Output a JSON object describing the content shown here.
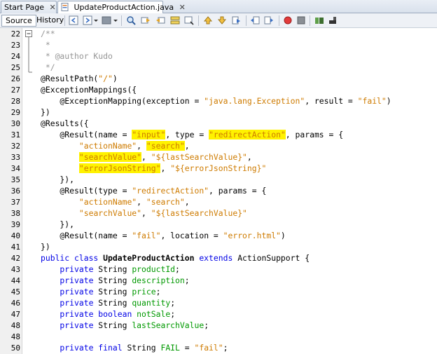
{
  "tabs": [
    {
      "label": "Start Page",
      "active": false
    },
    {
      "label": "UpdateProductAction.java",
      "active": true
    }
  ],
  "view_tabs": [
    {
      "label": "Source",
      "active": true
    },
    {
      "label": "History",
      "active": false
    }
  ],
  "toolbar_icons": [
    "back-icon",
    "forward-icon",
    "dropdown-icon",
    "history-icon",
    "dropdown-icon",
    "find-icon",
    "find-previous-icon",
    "find-next-icon",
    "toggle-highlight-icon",
    "find-selection-icon",
    "previous-bookmark-icon",
    "next-bookmark-icon",
    "toggle-bookmark-icon",
    "shift-left-icon",
    "shift-right-icon",
    "record-macro-icon",
    "stop-macro-icon",
    "comment-icon",
    "uncomment-icon"
  ],
  "colors": {
    "keyword": "#0000e6",
    "string": "#ce7b00",
    "comment": "#969696",
    "field": "#009900",
    "highlight": "#fff200"
  },
  "lines": [
    {
      "num": "22",
      "tokens": [
        {
          "t": "/**",
          "s": "c"
        }
      ]
    },
    {
      "num": "23",
      "tokens": [
        {
          "t": " *",
          "s": "c"
        }
      ]
    },
    {
      "num": "24",
      "tokens": [
        {
          "t": " * @author Kudo",
          "s": "c"
        }
      ]
    },
    {
      "num": "25",
      "tokens": [
        {
          "t": " */",
          "s": "c"
        }
      ]
    },
    {
      "num": "26",
      "tokens": [
        {
          "t": "@ResultPath(",
          "s": ""
        },
        {
          "t": "\"/\"",
          "s": "s"
        },
        {
          "t": ")",
          "s": ""
        }
      ]
    },
    {
      "num": "27",
      "tokens": [
        {
          "t": "@ExceptionMappings({",
          "s": ""
        }
      ]
    },
    {
      "num": "28",
      "tokens": [
        {
          "t": "    @ExceptionMapping(exception = ",
          "s": ""
        },
        {
          "t": "\"java.lang.Exception\"",
          "s": "s"
        },
        {
          "t": ", result = ",
          "s": ""
        },
        {
          "t": "\"fail\"",
          "s": "s"
        },
        {
          "t": ")",
          "s": ""
        }
      ]
    },
    {
      "num": "29",
      "tokens": [
        {
          "t": "})",
          "s": ""
        }
      ]
    },
    {
      "num": "30",
      "tokens": [
        {
          "t": "@Results({",
          "s": ""
        }
      ]
    },
    {
      "num": "31",
      "tokens": [
        {
          "t": "    @Result(name = ",
          "s": ""
        },
        {
          "t": "\"input\"",
          "s": "s hl"
        },
        {
          "t": ", type = ",
          "s": ""
        },
        {
          "t": "\"redirectAction\"",
          "s": "s hl"
        },
        {
          "t": ", params = {",
          "s": ""
        }
      ]
    },
    {
      "num": "32",
      "tokens": [
        {
          "t": "        ",
          "s": ""
        },
        {
          "t": "\"actionName\"",
          "s": "s"
        },
        {
          "t": ", ",
          "s": ""
        },
        {
          "t": "\"search\"",
          "s": "s hl"
        },
        {
          "t": ",",
          "s": ""
        }
      ]
    },
    {
      "num": "33",
      "tokens": [
        {
          "t": "        ",
          "s": ""
        },
        {
          "t": "\"searchValue\"",
          "s": "s hl"
        },
        {
          "t": ", ",
          "s": ""
        },
        {
          "t": "\"${lastSearchValue}\"",
          "s": "s"
        },
        {
          "t": ",",
          "s": ""
        }
      ]
    },
    {
      "num": "34",
      "tokens": [
        {
          "t": "        ",
          "s": ""
        },
        {
          "t": "\"errorJsonString\"",
          "s": "s hl"
        },
        {
          "t": ", ",
          "s": ""
        },
        {
          "t": "\"${errorJsonString}\"",
          "s": "s"
        }
      ]
    },
    {
      "num": "35",
      "tokens": [
        {
          "t": "    }),",
          "s": ""
        }
      ]
    },
    {
      "num": "36",
      "tokens": [
        {
          "t": "    @Result(type = ",
          "s": ""
        },
        {
          "t": "\"redirectAction\"",
          "s": "s"
        },
        {
          "t": ", params = {",
          "s": ""
        }
      ]
    },
    {
      "num": "37",
      "tokens": [
        {
          "t": "        ",
          "s": ""
        },
        {
          "t": "\"actionName\"",
          "s": "s"
        },
        {
          "t": ", ",
          "s": ""
        },
        {
          "t": "\"search\"",
          "s": "s"
        },
        {
          "t": ",",
          "s": ""
        }
      ]
    },
    {
      "num": "38",
      "tokens": [
        {
          "t": "        ",
          "s": ""
        },
        {
          "t": "\"searchValue\"",
          "s": "s"
        },
        {
          "t": ", ",
          "s": ""
        },
        {
          "t": "\"${lastSearchValue}\"",
          "s": "s"
        }
      ]
    },
    {
      "num": "39",
      "tokens": [
        {
          "t": "    }),",
          "s": ""
        }
      ]
    },
    {
      "num": "40",
      "tokens": [
        {
          "t": "    @Result(name = ",
          "s": ""
        },
        {
          "t": "\"fail\"",
          "s": "s"
        },
        {
          "t": ", location = ",
          "s": ""
        },
        {
          "t": "\"error.html\"",
          "s": "s"
        },
        {
          "t": ")",
          "s": ""
        }
      ]
    },
    {
      "num": "41",
      "tokens": [
        {
          "t": "})",
          "s": ""
        }
      ]
    },
    {
      "num": "42",
      "tokens": [
        {
          "t": "public class ",
          "s": "k"
        },
        {
          "t": "UpdateProductAction",
          "s": "cls"
        },
        {
          "t": " ",
          "s": ""
        },
        {
          "t": "extends",
          "s": "k"
        },
        {
          "t": " ActionSupport {",
          "s": ""
        }
      ]
    },
    {
      "num": "43",
      "tokens": [
        {
          "t": "    private",
          "s": "k"
        },
        {
          "t": " String ",
          "s": ""
        },
        {
          "t": "productId",
          "s": "f"
        },
        {
          "t": ";",
          "s": ""
        }
      ]
    },
    {
      "num": "44",
      "tokens": [
        {
          "t": "    private",
          "s": "k"
        },
        {
          "t": " String ",
          "s": ""
        },
        {
          "t": "description",
          "s": "f"
        },
        {
          "t": ";",
          "s": ""
        }
      ]
    },
    {
      "num": "45",
      "tokens": [
        {
          "t": "    private",
          "s": "k"
        },
        {
          "t": " String ",
          "s": ""
        },
        {
          "t": "price",
          "s": "f"
        },
        {
          "t": ";",
          "s": ""
        }
      ]
    },
    {
      "num": "46",
      "tokens": [
        {
          "t": "    private",
          "s": "k"
        },
        {
          "t": " String ",
          "s": ""
        },
        {
          "t": "quantity",
          "s": "f"
        },
        {
          "t": ";",
          "s": ""
        }
      ]
    },
    {
      "num": "47",
      "tokens": [
        {
          "t": "    private boolean",
          "s": "k"
        },
        {
          "t": " ",
          "s": ""
        },
        {
          "t": "notSale",
          "s": "f"
        },
        {
          "t": ";",
          "s": ""
        }
      ]
    },
    {
      "num": "48",
      "tokens": [
        {
          "t": "    private",
          "s": "k"
        },
        {
          "t": " String ",
          "s": ""
        },
        {
          "t": "lastSearchValue",
          "s": "f"
        },
        {
          "t": ";",
          "s": ""
        }
      ]
    },
    {
      "num": "48",
      "tokens": []
    },
    {
      "num": "50",
      "tokens": [
        {
          "t": "    private final",
          "s": "k"
        },
        {
          "t": " String ",
          "s": ""
        },
        {
          "t": "FAIL",
          "s": "f"
        },
        {
          "t": " = ",
          "s": ""
        },
        {
          "t": "\"fail\"",
          "s": "s"
        },
        {
          "t": ";",
          "s": ""
        }
      ]
    }
  ]
}
